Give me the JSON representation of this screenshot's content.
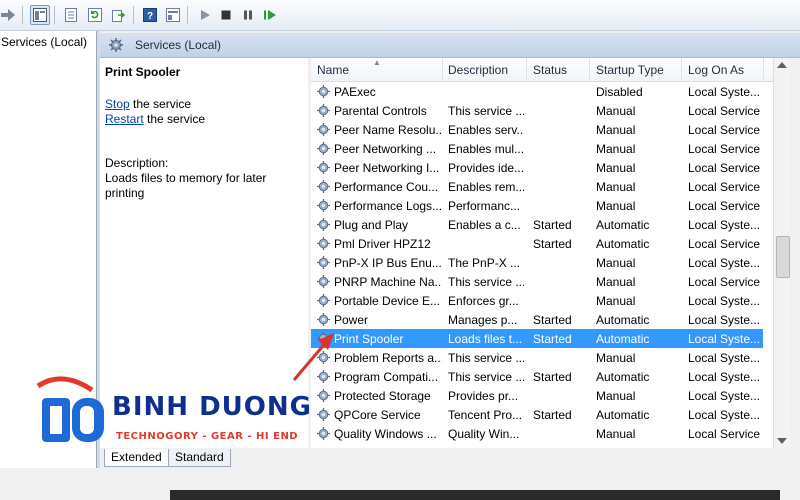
{
  "toolbar": {
    "icons": [
      "forward-arrow-icon",
      "console-view-icon",
      "properties-icon",
      "refresh-icon",
      "export-icon",
      "help-icon",
      "show-hide-icon",
      "play-icon",
      "stop-icon",
      "pause-icon",
      "restart-icon"
    ]
  },
  "tree": {
    "root_label": "Services (Local)"
  },
  "header": {
    "title": "Services (Local)"
  },
  "details": {
    "service_name": "Print Spooler",
    "stop_link": "Stop",
    "stop_suffix": " the service",
    "restart_link": "Restart",
    "restart_suffix": " the service",
    "description_label": "Description:",
    "description_text": "Loads files to memory for later printing"
  },
  "columns": {
    "name": "Name",
    "description": "Description",
    "status": "Status",
    "startup_type": "Startup Type",
    "log_on_as": "Log On As"
  },
  "rows": [
    {
      "name": "PAExec",
      "description": "",
      "status": "",
      "startup": "Disabled",
      "logon": "Local Syste..."
    },
    {
      "name": "Parental Controls",
      "description": "This service ...",
      "status": "",
      "startup": "Manual",
      "logon": "Local Service"
    },
    {
      "name": "Peer Name Resolu...",
      "description": "Enables serv...",
      "status": "",
      "startup": "Manual",
      "logon": "Local Service"
    },
    {
      "name": "Peer Networking ...",
      "description": "Enables mul...",
      "status": "",
      "startup": "Manual",
      "logon": "Local Service"
    },
    {
      "name": "Peer Networking I...",
      "description": "Provides ide...",
      "status": "",
      "startup": "Manual",
      "logon": "Local Service"
    },
    {
      "name": "Performance Cou...",
      "description": "Enables rem...",
      "status": "",
      "startup": "Manual",
      "logon": "Local Service"
    },
    {
      "name": "Performance Logs...",
      "description": "Performanc...",
      "status": "",
      "startup": "Manual",
      "logon": "Local Service"
    },
    {
      "name": "Plug and Play",
      "description": "Enables a c...",
      "status": "Started",
      "startup": "Automatic",
      "logon": "Local Syste..."
    },
    {
      "name": "Pml Driver HPZ12",
      "description": "",
      "status": "Started",
      "startup": "Automatic",
      "logon": "Local Service"
    },
    {
      "name": "PnP-X IP Bus Enu...",
      "description": "The PnP-X ...",
      "status": "",
      "startup": "Manual",
      "logon": "Local Syste..."
    },
    {
      "name": "PNRP Machine Na...",
      "description": "This service ...",
      "status": "",
      "startup": "Manual",
      "logon": "Local Service"
    },
    {
      "name": "Portable Device E...",
      "description": "Enforces gr...",
      "status": "",
      "startup": "Manual",
      "logon": "Local Syste..."
    },
    {
      "name": "Power",
      "description": "Manages p...",
      "status": "Started",
      "startup": "Automatic",
      "logon": "Local Syste..."
    },
    {
      "name": "Print Spooler",
      "description": "Loads files t...",
      "status": "Started",
      "startup": "Automatic",
      "logon": "Local Syste..."
    },
    {
      "name": "Problem Reports a...",
      "description": "This service ...",
      "status": "",
      "startup": "Manual",
      "logon": "Local Syste..."
    },
    {
      "name": "Program Compati...",
      "description": "This service ...",
      "status": "Started",
      "startup": "Automatic",
      "logon": "Local Syste..."
    },
    {
      "name": "Protected Storage",
      "description": "Provides pr...",
      "status": "",
      "startup": "Manual",
      "logon": "Local Syste..."
    },
    {
      "name": "QPCore Service",
      "description": "Tencent Pro...",
      "status": "Started",
      "startup": "Automatic",
      "logon": "Local Syste..."
    },
    {
      "name": "Quality Windows ...",
      "description": "Quality Win...",
      "status": "",
      "startup": "Manual",
      "logon": "Local Service"
    }
  ],
  "selected_row": 13,
  "tabs": {
    "extended": "Extended",
    "standard": "Standard"
  },
  "watermark": {
    "brand": "BINH DUONG",
    "tagline": "TECHNOGORY - GEAR - HI END"
  },
  "colors": {
    "selection": "#3399ff",
    "header_bg": "#c9d8ec",
    "link": "#0645ad",
    "logo_blue": "#0e2f8e",
    "logo_red": "#e23a2a"
  }
}
